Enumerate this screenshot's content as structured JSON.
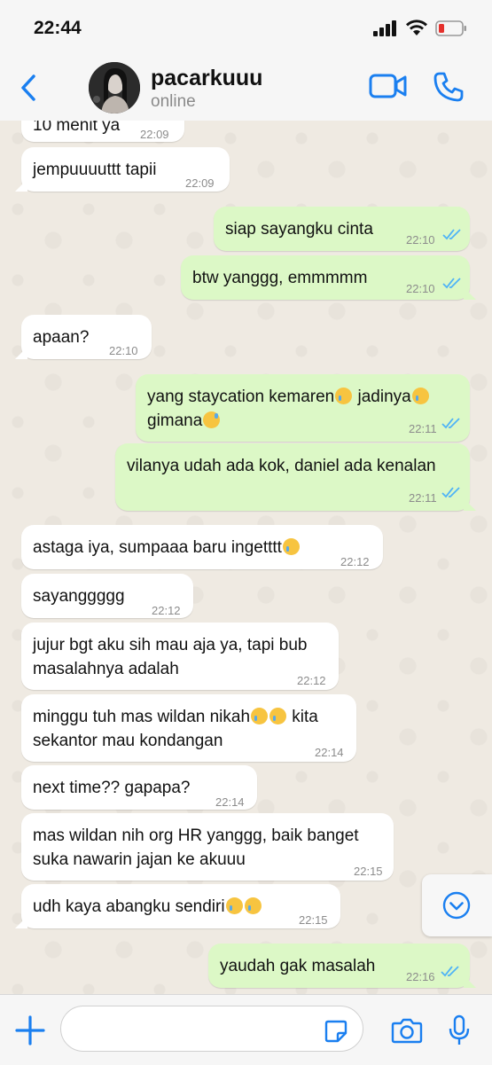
{
  "status_bar": {
    "time": "22:44"
  },
  "header": {
    "contact_name": "pacarkuuu",
    "status": "online"
  },
  "messages": [
    {
      "dir": "in",
      "text": "10 menit ya",
      "time": "22:09"
    },
    {
      "dir": "in",
      "text": "jempuuuuttt tapii",
      "time": "22:09"
    },
    {
      "dir": "out",
      "text": "siap sayangku cinta",
      "time": "22:10"
    },
    {
      "dir": "out",
      "text": "btw yanggg, emmmmm",
      "time": "22:10"
    },
    {
      "dir": "in",
      "text": "apaan?",
      "time": "22:10"
    },
    {
      "dir": "out",
      "line1_a": "yang staycation kemaren",
      "line1_b": " jadinya",
      "line2": "gimana",
      "time": "22:11"
    },
    {
      "dir": "out",
      "text": "vilanya udah ada kok, daniel ada kenalan",
      "time": "22:11"
    },
    {
      "dir": "in",
      "text": "astaga iya, sumpaaa baru ingetttt",
      "time": "22:12"
    },
    {
      "dir": "in",
      "text": "sayanggggg",
      "time": "22:12"
    },
    {
      "dir": "in",
      "line1": "jujur bgt aku sih mau aja ya, tapi bub",
      "line2": "masalahnya adalah",
      "time": "22:12"
    },
    {
      "dir": "in",
      "line1": "minggu tuh mas wildan nikah",
      "line1_b": " kita",
      "line2": "sekantor mau kondangan",
      "time": "22:14"
    },
    {
      "dir": "in",
      "text": "next time?? gapapa?",
      "time": "22:14"
    },
    {
      "dir": "in",
      "line1": "mas wildan nih org HR yanggg, baik banget",
      "line2": "suka nawarin jajan ke akuuu",
      "time": "22:15"
    },
    {
      "dir": "in",
      "text": "udh kaya abangku sendiri",
      "time": "22:15"
    },
    {
      "dir": "out",
      "text": "yaudah gak masalah",
      "time": "22:16"
    }
  ],
  "composer": {
    "placeholder": ""
  },
  "colors": {
    "accent": "#1a7ff0",
    "outgoing_bubble": "#dcf8c6",
    "incoming_bubble": "#ffffff",
    "read_ticks": "#4fb3f6"
  }
}
